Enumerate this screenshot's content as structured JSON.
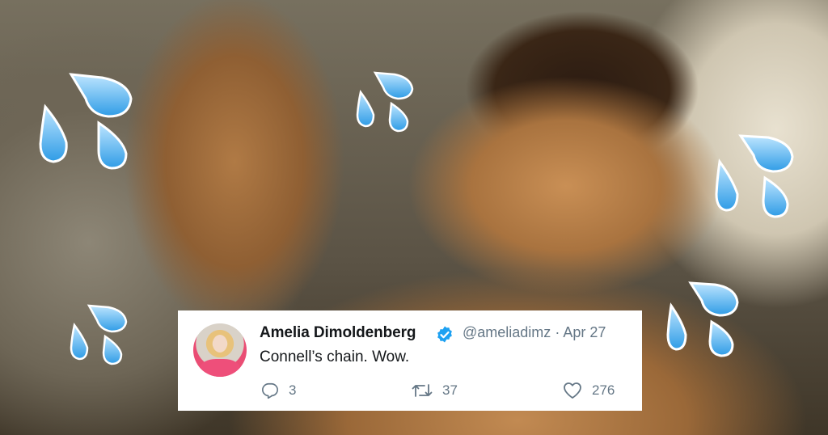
{
  "tweet": {
    "author_name": "Amelia Dimoldenberg",
    "handle": "@ameliadimz",
    "separator": "·",
    "date": "Apr 27",
    "text": "Connell’s chain. Wow.",
    "replies": "3",
    "retweets": "37",
    "likes": "276"
  },
  "icons": {
    "verified": "verified-badge-icon",
    "reply": "reply-icon",
    "retweet": "retweet-icon",
    "like": "heart-icon",
    "overlay": "sweat-droplets-emoji"
  },
  "colors": {
    "verified_blue": "#1da1f2",
    "text_primary": "#14171a",
    "text_secondary": "#657786",
    "card_bg": "#ffffff"
  }
}
